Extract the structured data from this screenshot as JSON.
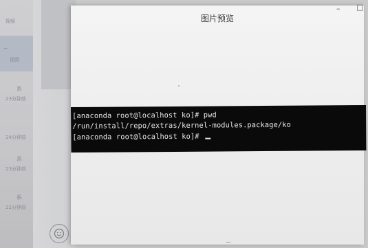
{
  "sidebar": {
    "items": [
      {
        "a": "",
        "b": "视频"
      },
      {
        "a": "_",
        "b": "视频"
      },
      {
        "a": "系",
        "b": "23分钟前"
      },
      {
        "a": "",
        "b": "24分钟前"
      },
      {
        "a": "系",
        "b": "23分钟前"
      },
      {
        "a": "系",
        "b": "22分钟前"
      }
    ]
  },
  "chat": {
    "emoji_icon": "smiley-icon"
  },
  "preview": {
    "title": "图片预览",
    "minimize_glyph": "–",
    "maximize_glyph": "□"
  },
  "terminal": {
    "lines": [
      "[anaconda root@localhost ko]# pwd",
      "/run/install/repo/extras/kernel-modules.package/ko",
      "[anaconda root@localhost ko]# "
    ]
  }
}
